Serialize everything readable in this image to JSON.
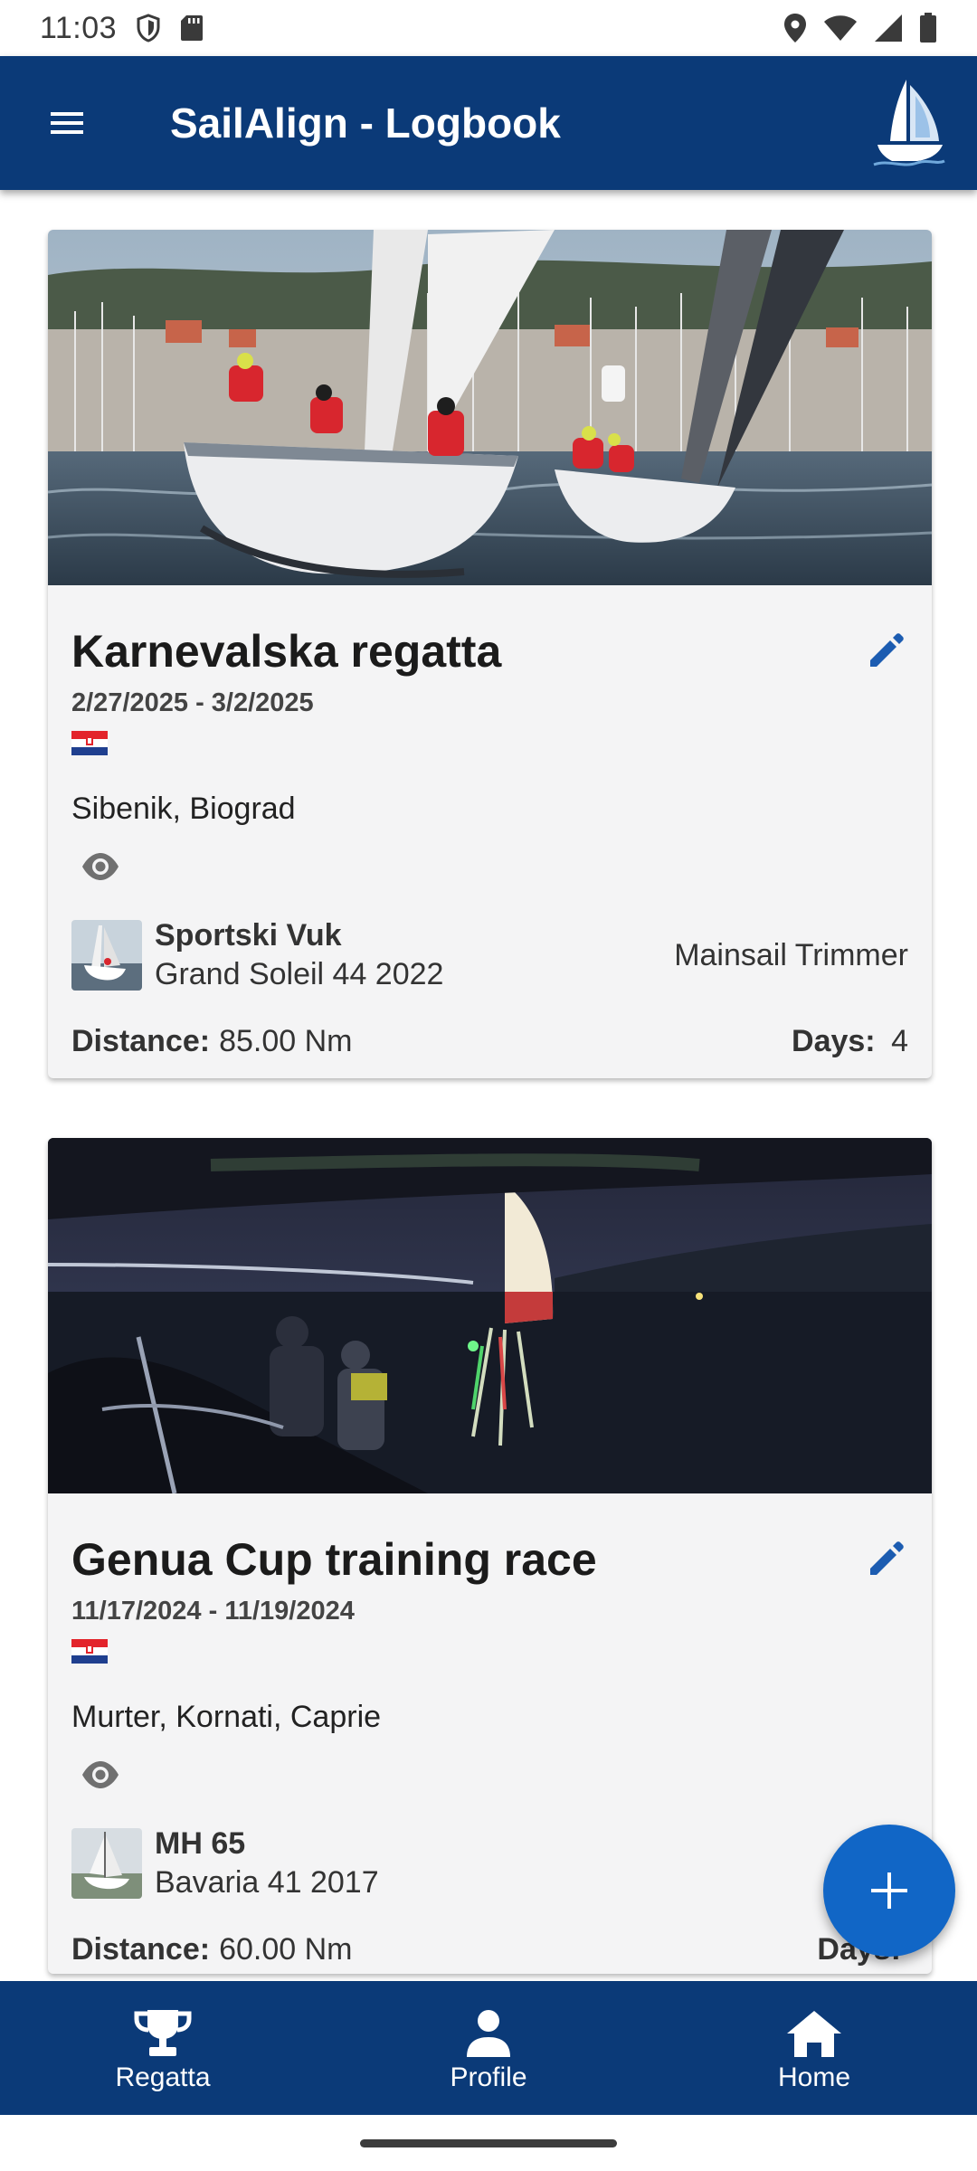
{
  "status_bar": {
    "time": "11:03",
    "icons": [
      "shield-icon",
      "sd-card-icon",
      "location-icon",
      "wifi-icon",
      "signal-icon",
      "battery-icon"
    ]
  },
  "app_bar": {
    "title": "SailAlign - Logbook",
    "menu_icon": "menu-icon",
    "logo": "sailboat-logo"
  },
  "colors": {
    "primary": "#0b3a78",
    "accent": "#1166c6",
    "card_bg": "#f4f4f5"
  },
  "regattas": [
    {
      "title": "Karnevalska regatta",
      "dates": "2/27/2025 - 3/2/2025",
      "flag": "croatia-flag",
      "location": "Sibenik, Biograd",
      "boat_name": "Sportski Vuk",
      "boat_model": "Grand Soleil 44 2022",
      "role": "Mainsail Trimmer",
      "distance_label": "Distance:",
      "distance_value": "85.00 Nm",
      "days_label": "Days:",
      "days_value": "4"
    },
    {
      "title": "Genua Cup training race",
      "dates": "11/17/2024 - 11/19/2024",
      "flag": "croatia-flag",
      "location": "Murter, Kornati, Caprie",
      "boat_name": "MH 65",
      "boat_model": "Bavaria 41 2017",
      "role": "",
      "distance_label": "Distance:",
      "distance_value": "60.00 Nm",
      "days_label": "Days:",
      "days_value": ""
    }
  ],
  "fab": {
    "icon": "plus-icon"
  },
  "bottom_nav": {
    "items": [
      {
        "label": "Regatta",
        "icon": "trophy-icon"
      },
      {
        "label": "Profile",
        "icon": "person-icon"
      },
      {
        "label": "Home",
        "icon": "home-icon"
      }
    ]
  }
}
